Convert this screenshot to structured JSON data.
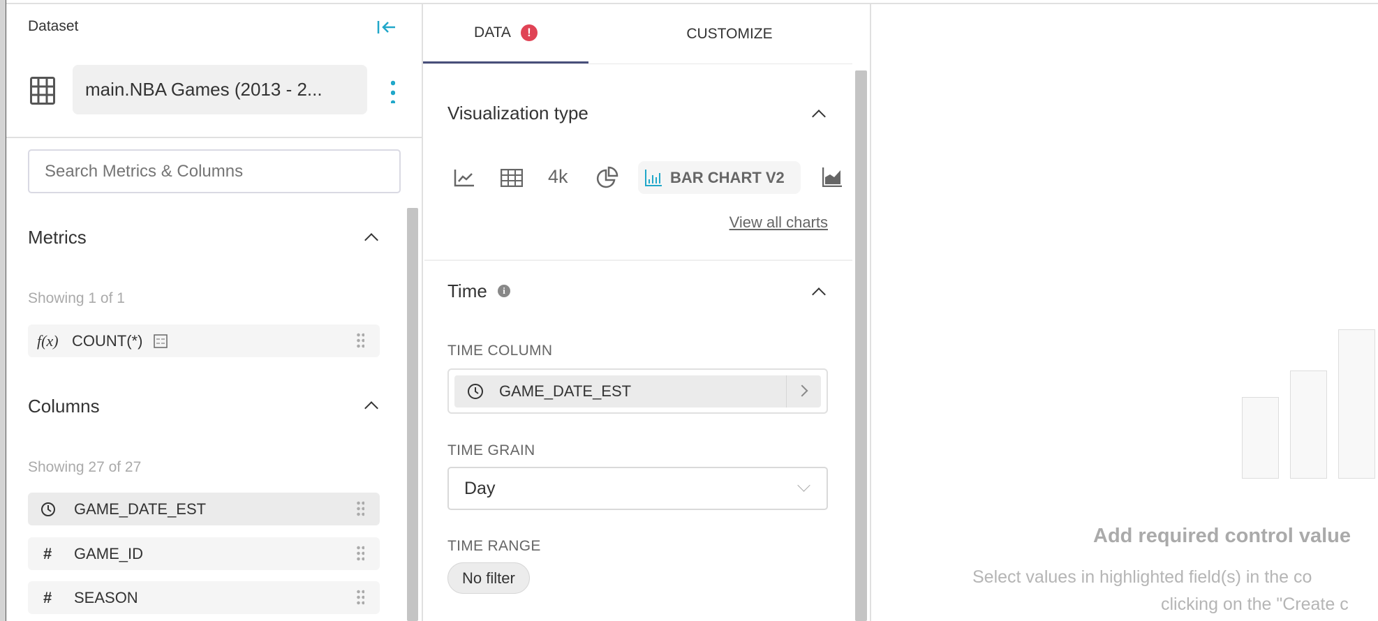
{
  "sidebar": {
    "title": "Dataset",
    "dataset_name": "main.NBA Games (2013 - 2...",
    "search_placeholder": "Search Metrics & Columns",
    "metrics": {
      "title": "Metrics",
      "showing": "Showing 1 of 1",
      "items": [
        {
          "icon": "function-icon",
          "icon_text": "f(x)",
          "label": "COUNT(*)"
        }
      ]
    },
    "columns": {
      "title": "Columns",
      "showing": "Showing 27 of 27",
      "items": [
        {
          "icon": "clock-icon",
          "label": "GAME_DATE_EST"
        },
        {
          "icon": "hash-icon",
          "icon_text": "#",
          "label": "GAME_ID"
        },
        {
          "icon": "hash-icon",
          "icon_text": "#",
          "label": "SEASON"
        }
      ]
    }
  },
  "control_panel": {
    "tabs": [
      {
        "label": "DATA",
        "active": true,
        "error": true
      },
      {
        "label": "CUSTOMIZE",
        "active": false
      }
    ],
    "viz": {
      "title": "Visualization type",
      "big_number_label": "4k",
      "selected_label": "BAR CHART V2",
      "view_all": "View all charts"
    },
    "time": {
      "title": "Time",
      "time_column_label": "TIME COLUMN",
      "time_column_value": "GAME_DATE_EST",
      "time_grain_label": "TIME GRAIN",
      "time_grain_value": "Day",
      "time_range_label": "TIME RANGE",
      "time_range_value": "No filter"
    }
  },
  "chart_area": {
    "heading": "Add required control value",
    "line1": "Select values in highlighted field(s) in the co",
    "line2": "clicking on the \"Create c"
  },
  "colors": {
    "accent": "#20a7c9",
    "tab_underline": "#484f7a",
    "error": "#e04355"
  }
}
